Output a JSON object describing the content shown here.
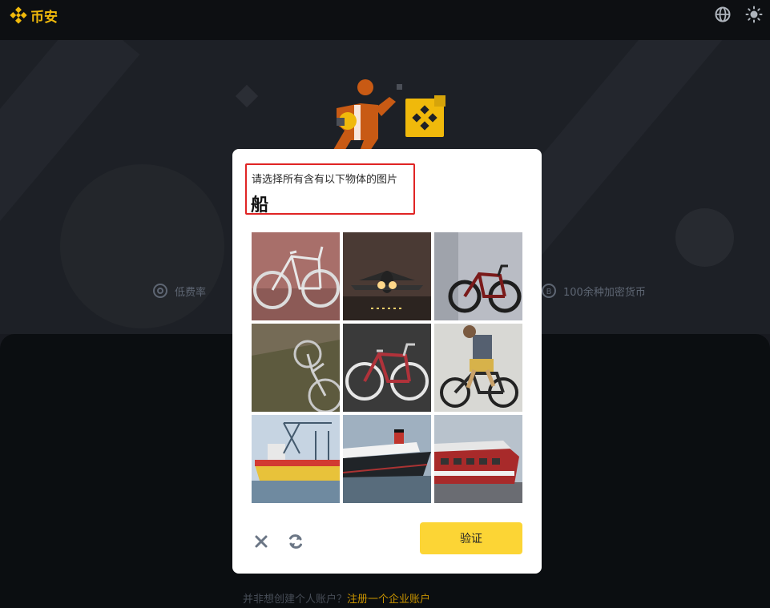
{
  "header": {
    "brand_name": "币安",
    "brand_color": "#f0b90b",
    "icons": [
      "binance-logo-icon",
      "globe-icon",
      "sun-icon"
    ]
  },
  "hero": {
    "features": [
      {
        "label": "低费率",
        "icon": "fee-icon"
      },
      {
        "label": "100余种加密货币",
        "icon": "coin-icon"
      }
    ]
  },
  "footer": {
    "question": "并非想创建个人账户？",
    "link": "注册一个企业账户"
  },
  "captcha": {
    "instruction": "请选择所有含有以下物体的图片",
    "target_word": "船",
    "tiles": [
      {
        "subject": "bicycle"
      },
      {
        "subject": "airplane"
      },
      {
        "subject": "bicycle"
      },
      {
        "subject": "bicycle"
      },
      {
        "subject": "bicycle"
      },
      {
        "subject": "cyclist-on-bicycle"
      },
      {
        "subject": "cargo-ship"
      },
      {
        "subject": "ocean-liner"
      },
      {
        "subject": "ferry-boat"
      }
    ],
    "verify_label": "验证",
    "verify_color": "#fcd535",
    "highlight_color": "#e02424"
  }
}
